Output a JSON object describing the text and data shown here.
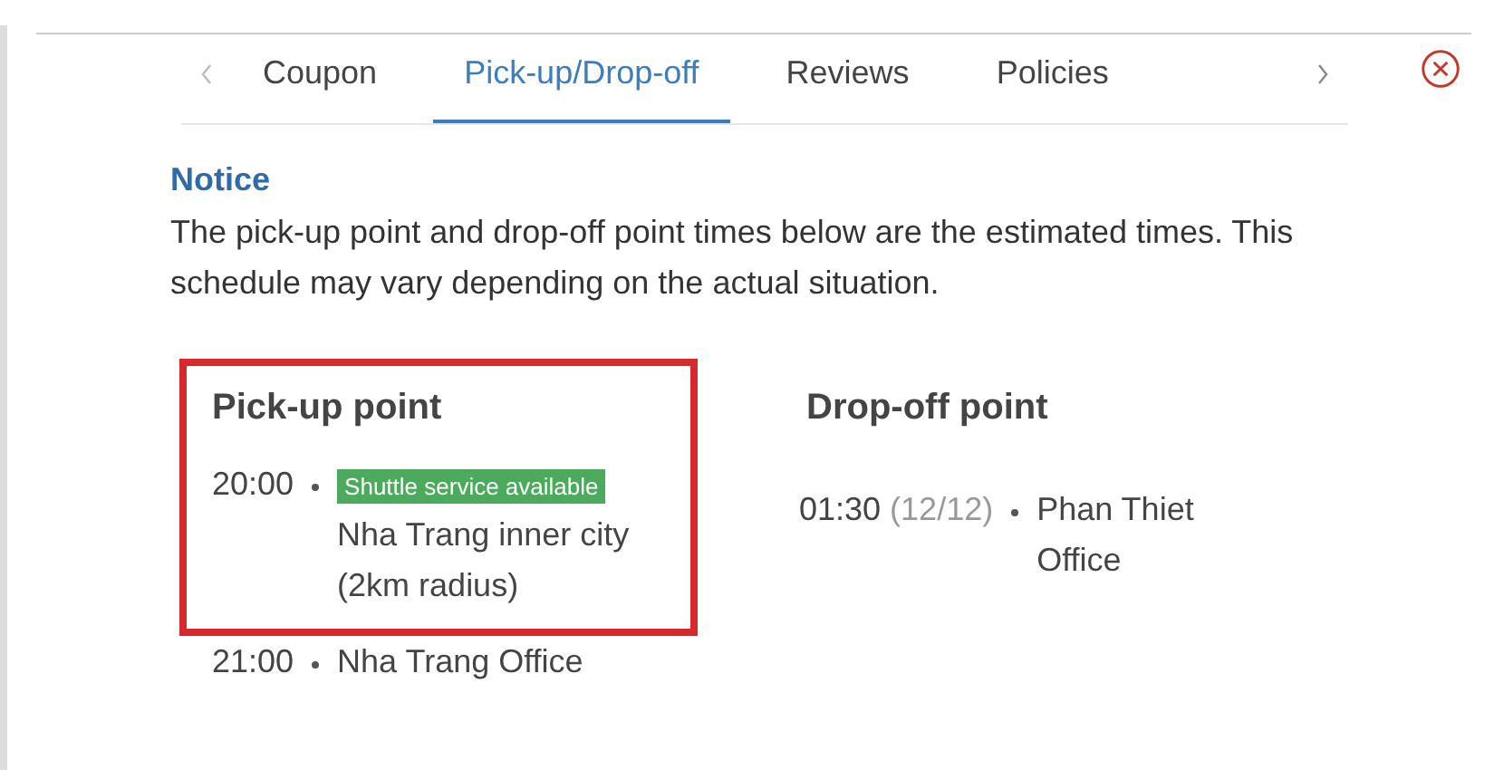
{
  "tabs": [
    {
      "label": "Coupon",
      "selected": false
    },
    {
      "label": "Pick-up/Drop-off",
      "selected": true
    },
    {
      "label": "Reviews",
      "selected": false
    },
    {
      "label": "Policies",
      "selected": false
    }
  ],
  "notice": {
    "title": "Notice",
    "text": "The pick-up point and drop-off point times below are the estimated times. This schedule may vary depending on the actual situation."
  },
  "points": [
    {
      "title": "Pick-up point",
      "stops": [
        {
          "time": "20:00",
          "badge": "Shuttle service available",
          "place": "Nha Trang inner city (2km radius)",
          "highlighted": true
        },
        {
          "time": "21:00",
          "place": "Nha Trang Office",
          "highlighted": false
        }
      ]
    },
    {
      "title": "Drop-off point",
      "stops": [
        {
          "time": "01:30",
          "date": "(12/12)",
          "place": "Phan Thiet Office",
          "highlighted": false
        }
      ]
    }
  ]
}
